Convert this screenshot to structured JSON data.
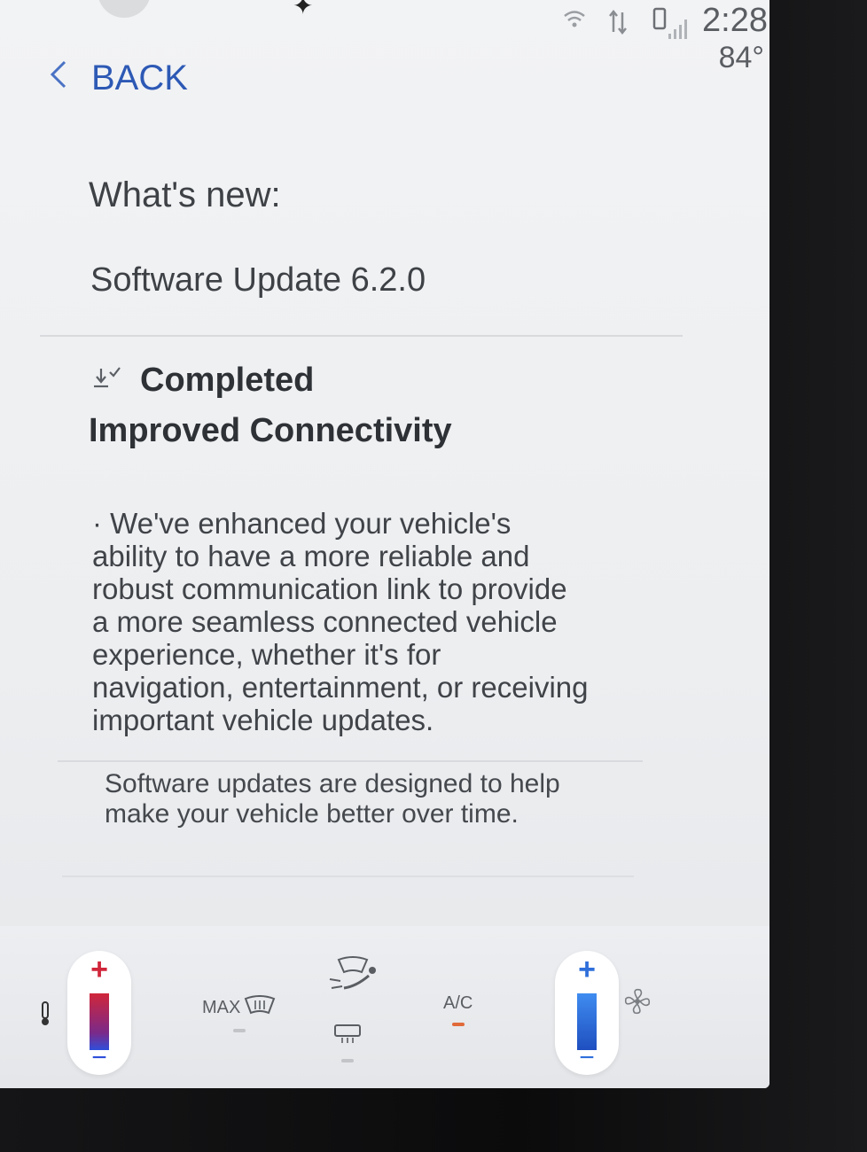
{
  "status": {
    "time": "2:28",
    "temperature": "84°",
    "icons": [
      "wifi-icon",
      "data-transfer-icon",
      "phone-signal-icon"
    ]
  },
  "nav": {
    "back_label": "BACK"
  },
  "content": {
    "heading": "What's new:",
    "update_title": "Software Update 6.2.0",
    "status_label": "Completed",
    "feature_title": "Improved Connectivity",
    "bullet": "·",
    "description": "We've enhanced your vehicle's ability to have a more reliable and robust communication link to provide a more seamless connected vehicle experience, whether it's for navigation, entertainment, or receiving important vehicle updates.",
    "note": "Software updates are designed to help make your vehicle better over time."
  },
  "climate": {
    "max_defrost_label": "MAX",
    "ac_label": "A/C",
    "plus_symbol": "+",
    "minus_symbol": "−",
    "colors": {
      "heat": "#d0263a",
      "cool": "#2f6fdb",
      "ac_active": "#e06a3a"
    }
  }
}
